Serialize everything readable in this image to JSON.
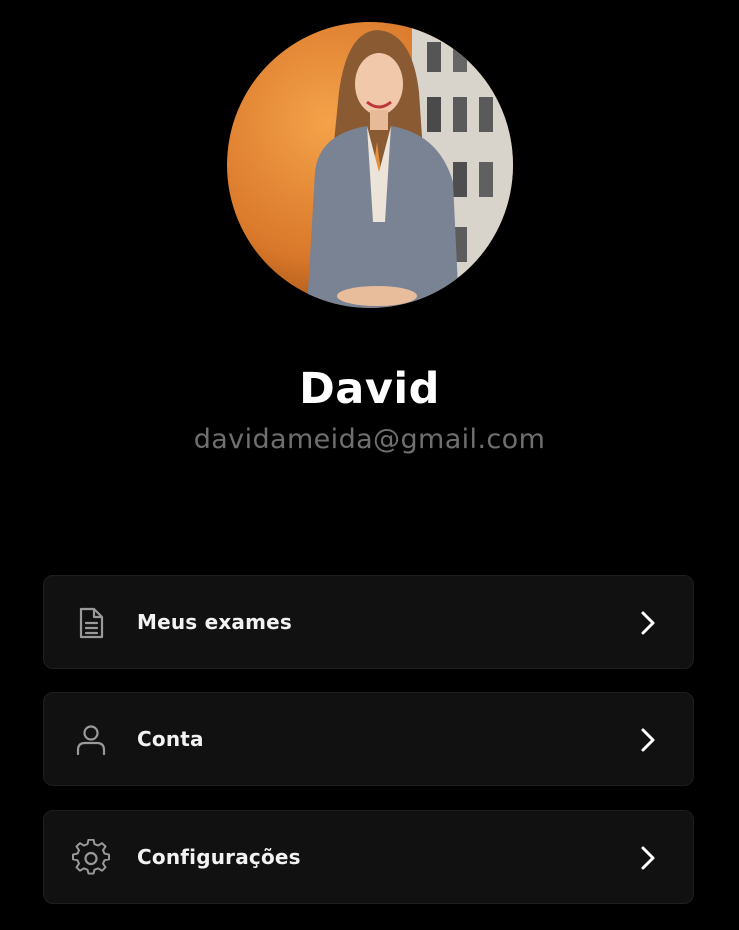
{
  "profile": {
    "name": "David",
    "email": "davidameida@gmail.com",
    "avatar_icon": "profile-photo"
  },
  "menu": {
    "items": [
      {
        "label": "Meus exames",
        "icon": "document-icon"
      },
      {
        "label": "Conta",
        "icon": "user-icon"
      },
      {
        "label": "Configurações",
        "icon": "gear-icon"
      }
    ]
  },
  "colors": {
    "background": "#000000",
    "card": "#111111",
    "email_text": "#6f6f6f",
    "icon_stroke": "#9a9a9a"
  }
}
